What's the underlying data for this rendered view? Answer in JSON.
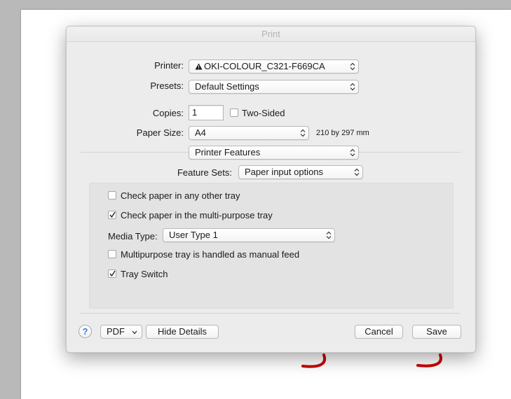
{
  "dialog": {
    "title": "Print"
  },
  "printer": {
    "label": "Printer:",
    "value": "OKI-COLOUR_C321-F669CA",
    "icon": "warning-icon"
  },
  "presets": {
    "label": "Presets:",
    "value": "Default Settings"
  },
  "copies": {
    "label": "Copies:",
    "value": "1",
    "two_sided_label": "Two-Sided",
    "two_sided_checked": false
  },
  "paper_size": {
    "label": "Paper Size:",
    "value": "A4",
    "dimensions": "210 by 297 mm"
  },
  "section_menu": {
    "value": "Printer Features"
  },
  "feature_sets": {
    "label": "Feature Sets:",
    "value": "Paper input options"
  },
  "options": {
    "check_other_tray": {
      "label": "Check paper in any other tray",
      "checked": false
    },
    "check_multipurpose": {
      "label": "Check paper in the multi-purpose tray",
      "checked": true
    },
    "media_type": {
      "label": "Media Type:",
      "value": "User Type 1"
    },
    "manual_feed": {
      "label": "Multipurpose tray is handled as manual feed",
      "checked": false
    },
    "tray_switch": {
      "label": "Tray Switch",
      "checked": true
    }
  },
  "footer": {
    "help_label": "?",
    "pdf_label": "PDF",
    "hide_details_label": "Hide Details",
    "cancel_label": "Cancel",
    "save_label": "Save"
  },
  "colors": {
    "accent": "#3b7ddd",
    "background_mark": "#cc0000"
  }
}
